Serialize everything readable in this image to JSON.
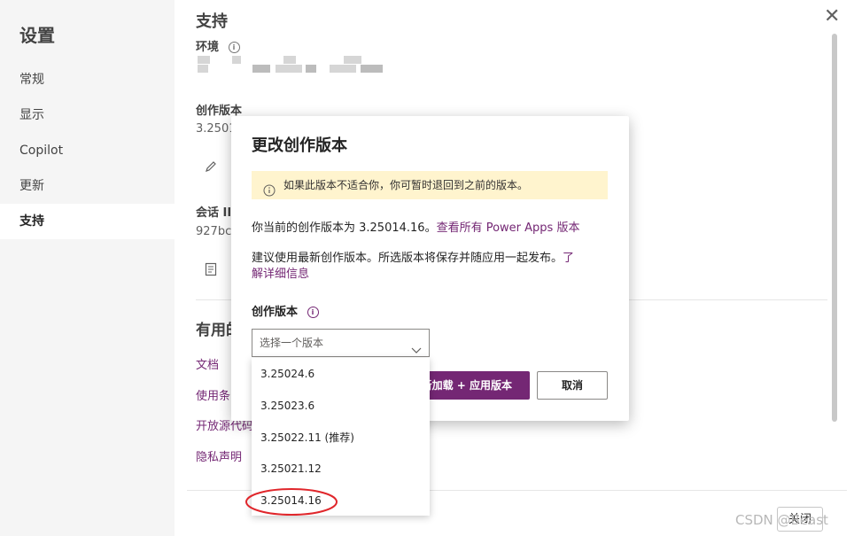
{
  "sidebar": {
    "title": "设置",
    "items": [
      {
        "label": "常规"
      },
      {
        "label": "显示"
      },
      {
        "label": "Copilot"
      },
      {
        "label": "更新"
      },
      {
        "label": "支持"
      }
    ],
    "selected_index": 4
  },
  "support": {
    "title": "支持",
    "environment_label": "环境",
    "authoring_version_label": "创作版本",
    "authoring_version_value": "3.2501",
    "session_label": "会话 II",
    "session_value": "927bc",
    "useful_section_title": "有用的",
    "links": [
      "文档",
      "使用条",
      "开放源代码",
      "隐私声明"
    ]
  },
  "footer": {
    "close_label": "关闭"
  },
  "watermark": "CSDN @Beast",
  "dialog": {
    "title": "更改创作版本",
    "warning_text": "如果此版本不适合你，你可暂时退回到之前的版本。",
    "current_version_text": "你当前的创作版本为 3.25014.16。",
    "view_all_link": "查看所有 Power Apps 版本",
    "recommend_text": "建议使用最新创作版本。所选版本将保存并随应用一起发布。",
    "learn_more_link_1": "了",
    "learn_more_link_2": "解详细信息",
    "field_label": "创作版本",
    "select_placeholder": "选择一个版本",
    "primary_button": "新加载 + 应用版本",
    "cancel_button": "取消"
  },
  "dropdown_options": [
    "3.25024.6",
    "3.25023.6",
    "3.25022.11 (推荐)",
    "3.25021.12",
    "3.25014.16"
  ],
  "colors": {
    "accent": "#742774",
    "warning_bg": "#fff4ce",
    "highlight_ring": "#e0262b"
  }
}
